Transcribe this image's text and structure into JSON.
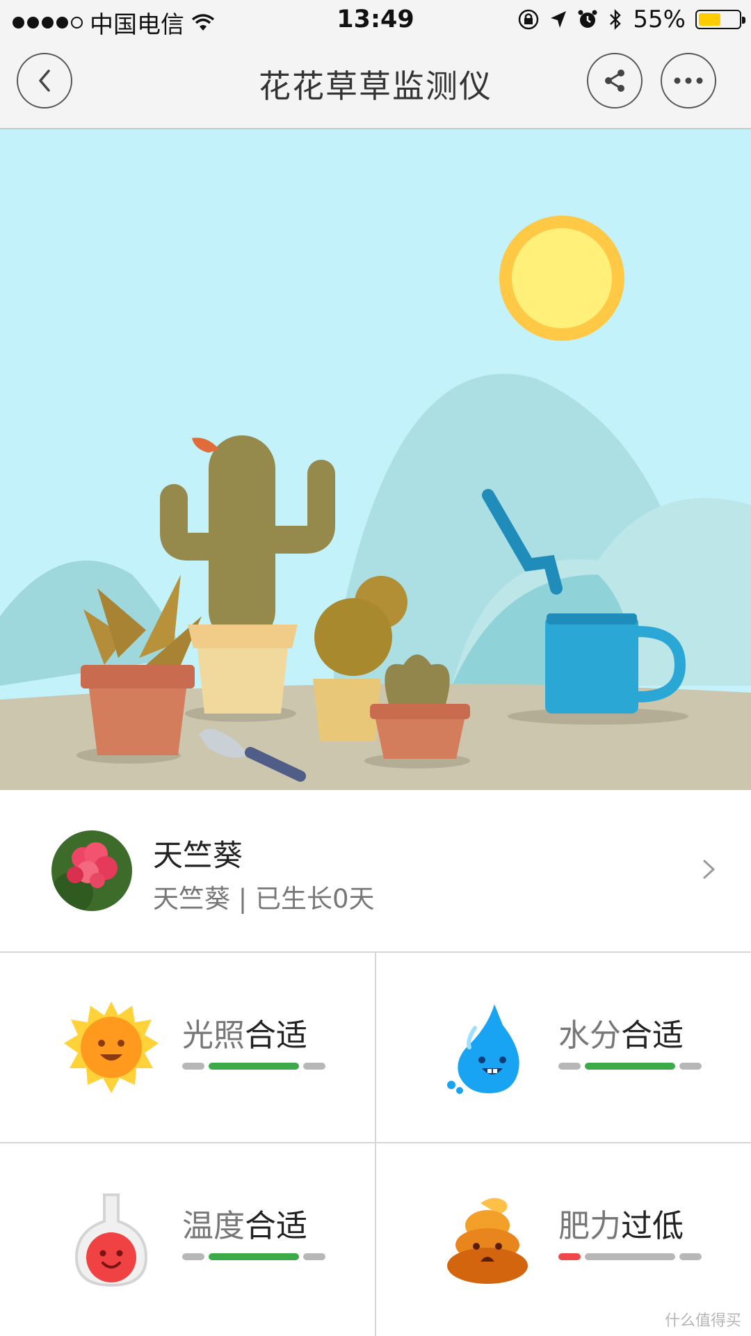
{
  "status_bar": {
    "carrier": "中国电信",
    "time": "13:49",
    "battery_percent_label": "55%",
    "battery_level": 0.55,
    "signal_bars": 4,
    "icons": [
      "wifi-icon",
      "rotation-lock-icon",
      "location-arrow-icon",
      "alarm-icon",
      "bluetooth-icon",
      "battery-icon"
    ]
  },
  "nav": {
    "title": "花花草草监测仪",
    "icons": [
      "back-chevron-icon",
      "share-icon",
      "more-dots-icon"
    ]
  },
  "plant": {
    "name": "天竺葵",
    "subtitle": "天竺葵 | 已生长0天",
    "chevron_icon": "chevron-right-icon"
  },
  "metrics": [
    {
      "id": "light",
      "icon": "sun-face-icon",
      "key": "光照",
      "status": "合适",
      "level": "normal"
    },
    {
      "id": "water",
      "icon": "water-drop-face-icon",
      "key": "水分",
      "status": "合适",
      "level": "normal"
    },
    {
      "id": "temperature",
      "icon": "thermometer-bulb-face-icon",
      "key": "温度",
      "status": "合适",
      "level": "normal"
    },
    {
      "id": "fertility",
      "icon": "poop-face-icon",
      "key": "肥力",
      "status": "过低",
      "level": "low"
    }
  ],
  "colors": {
    "good": "#3daa4a",
    "low": "#f0484a",
    "inactive": "#b7b7b7",
    "sky": "#c3f2fb",
    "battery": "#ffcc00"
  },
  "watermark": "什么值得买"
}
